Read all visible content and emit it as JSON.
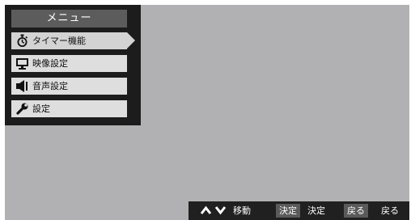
{
  "menu": {
    "title": "メニュー",
    "items": [
      {
        "label": "タイマー機能",
        "icon": "stopwatch-icon",
        "selected": true
      },
      {
        "label": "映像設定",
        "icon": "monitor-icon",
        "selected": false
      },
      {
        "label": "音声設定",
        "icon": "speaker-icon",
        "selected": false
      },
      {
        "label": "設定",
        "icon": "wrench-icon",
        "selected": false
      }
    ]
  },
  "footer": {
    "move_label": "移動",
    "confirm_key": "決定",
    "confirm_label": "決定",
    "back_key": "戻る",
    "back_label": "戻る"
  },
  "colors": {
    "screen_background": "#b1b1b3",
    "menu_background": "#1c1c1c",
    "title_background": "#5c5c5c",
    "item_background": "#dedede",
    "footer_background": "#202020",
    "key_badge_background": "#5a5a5a"
  }
}
